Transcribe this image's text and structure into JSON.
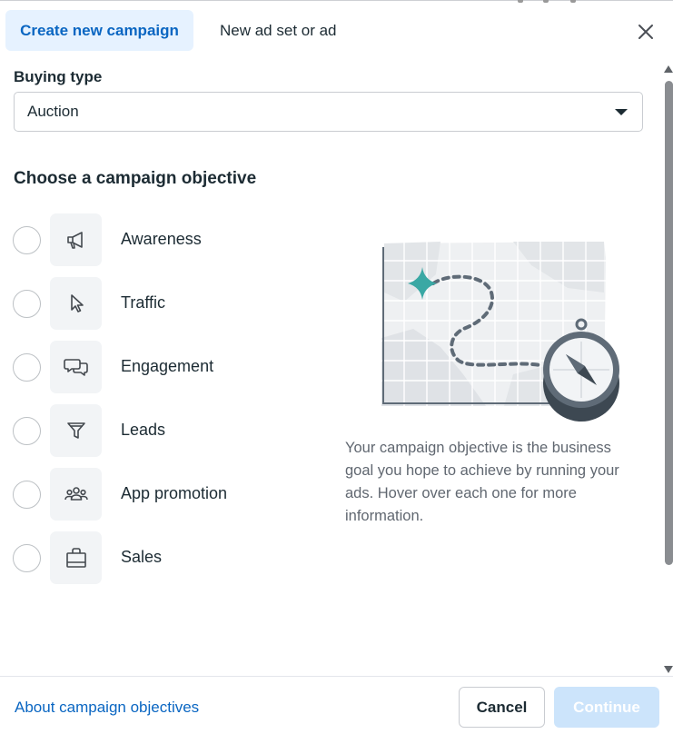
{
  "tabs": [
    {
      "label": "Create new campaign",
      "active": true
    },
    {
      "label": "New ad set or ad",
      "active": false
    }
  ],
  "buying": {
    "label": "Buying type",
    "value": "Auction"
  },
  "objectives": {
    "title": "Choose a campaign objective",
    "items": [
      {
        "label": "Awareness",
        "icon": "megaphone-icon"
      },
      {
        "label": "Traffic",
        "icon": "cursor-icon"
      },
      {
        "label": "Engagement",
        "icon": "chat-bubbles-icon"
      },
      {
        "label": "Leads",
        "icon": "funnel-icon"
      },
      {
        "label": "App promotion",
        "icon": "people-icon"
      },
      {
        "label": "Sales",
        "icon": "shopping-bag-icon"
      }
    ]
  },
  "description": "Your campaign objective is the business goal you hope to achieve by running your ads. Hover over each one for more information.",
  "footer": {
    "link": "About campaign objectives",
    "cancel": "Cancel",
    "continue": "Continue",
    "continue_enabled": false
  },
  "colors": {
    "accent": "#0a66c2",
    "tab_active_bg": "#e6f2ff",
    "continue_disabled_bg": "#cce4fb",
    "illustration_teal": "#3aa8a4"
  }
}
